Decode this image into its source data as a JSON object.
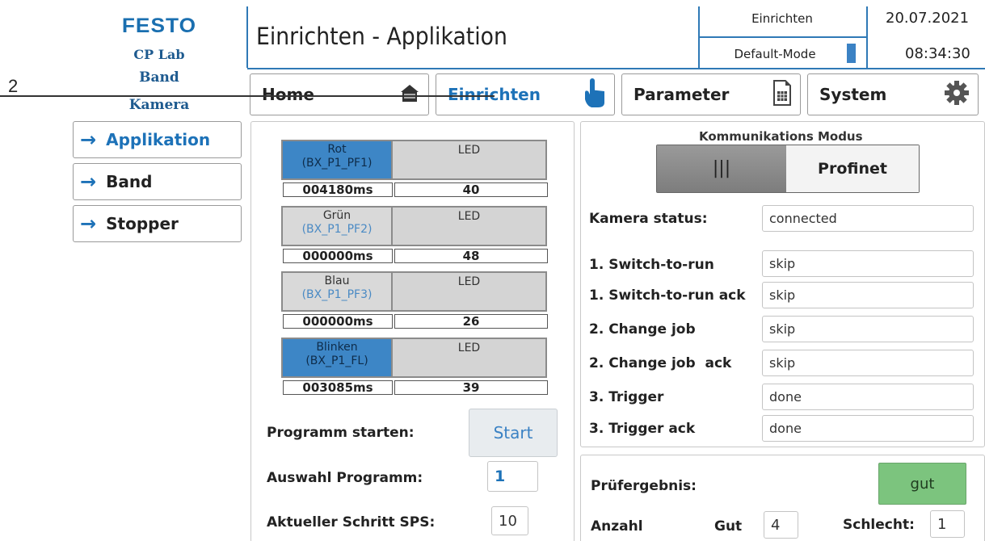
{
  "annotation": {
    "number": "2"
  },
  "header": {
    "logo": "FESTO",
    "line1": "CP Lab",
    "line2": "Band",
    "line3": "Kamera",
    "title": "Einrichten - Applikation",
    "mode": "Einrichten",
    "submode": "Default-Mode",
    "date": "20.07.2021",
    "time": "08:34:30"
  },
  "nav": {
    "home": "Home",
    "einrichten": "Einrichten",
    "parameter": "Parameter",
    "system": "System"
  },
  "sidebar": {
    "items": [
      {
        "label": "Applikation"
      },
      {
        "label": "Band"
      },
      {
        "label": "Stopper"
      }
    ]
  },
  "leds": [
    {
      "name": "Rot",
      "code": "(BX_P1_PF1)",
      "led": "LED",
      "time": "004180ms",
      "value": "40"
    },
    {
      "name": "Grün",
      "code": "(BX_P1_PF2)",
      "led": "LED",
      "time": "000000ms",
      "value": "48"
    },
    {
      "name": "Blau",
      "code": "(BX_P1_PF3)",
      "led": "LED",
      "time": "000000ms",
      "value": "26"
    },
    {
      "name": "Blinken",
      "code": "(BX_P1_FL)",
      "led": "LED",
      "time": "003085ms",
      "value": "39"
    }
  ],
  "program": {
    "start_label": "Programm starten:",
    "start_button": "Start",
    "select_label": "Auswahl Programm:",
    "select_value": "1",
    "step_label": "Aktueller Schritt SPS:",
    "step_value": "10"
  },
  "comm": {
    "title": "Kommunikations Modus",
    "toggle_left": "|||",
    "toggle_right": "Profinet"
  },
  "camera": {
    "status_label": "Kamera status:",
    "status_value": "connected",
    "rows": [
      {
        "label": "1. Switch-to-run",
        "value": "skip"
      },
      {
        "label": "1. Switch-to-run ack",
        "value": "skip"
      },
      {
        "label": "2. Change job",
        "value": "skip"
      },
      {
        "label": "2. Change job  ack",
        "value": "skip"
      },
      {
        "label": "3. Trigger",
        "value": "done"
      },
      {
        "label": "3. Trigger ack",
        "value": "done"
      }
    ]
  },
  "result": {
    "label": "Prüfergebnis:",
    "value": "gut",
    "count_label": "Anzahl",
    "good_label": "Gut",
    "good_value": "4",
    "bad_label": "Schlecht:",
    "bad_value": "1"
  },
  "colors": {
    "accent": "#1d72b8",
    "led_active": "#3d86c6",
    "result_good": "#7cc47e"
  }
}
